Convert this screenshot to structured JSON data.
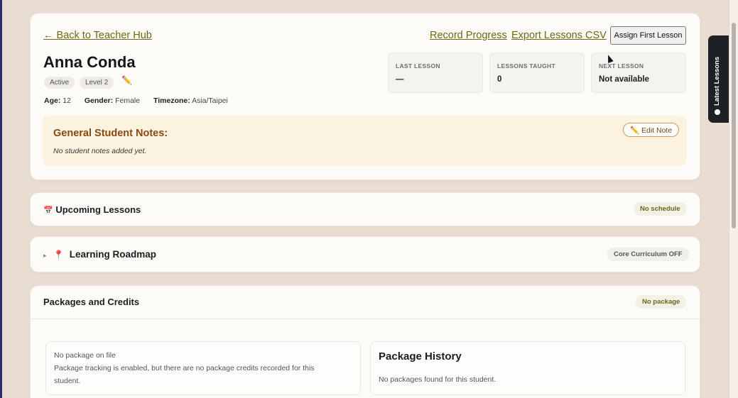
{
  "header": {
    "back_link": "← Back to Teacher Hub",
    "record_progress": "Record Progress",
    "export_csv": "Export Lessons CSV",
    "assign_first_lesson": "Assign First Lesson"
  },
  "student": {
    "name": "Anna Conda",
    "status": "Active",
    "level": "Level 2",
    "age_label": "Age:",
    "age": "12",
    "gender_label": "Gender:",
    "gender": "Female",
    "timezone_label": "Timezone:",
    "timezone": "Asia/Taipei"
  },
  "stats": [
    {
      "label": "LAST LESSON",
      "value": "—"
    },
    {
      "label": "LESSONS TAUGHT",
      "value": "0"
    },
    {
      "label": "NEXT LESSON",
      "value": "Not available"
    }
  ],
  "notes": {
    "title": "General Student Notes:",
    "empty": "No student notes added yet.",
    "edit_label": "✏️ Edit Note"
  },
  "upcoming": {
    "icon": "📅",
    "title": "Upcoming Lessons",
    "badge": "No schedule",
    "badge_color": "#5f6b1a"
  },
  "roadmap": {
    "caret": "▸",
    "icon": "📍",
    "title": "Learning Roadmap",
    "badge": "Core Curriculum OFF"
  },
  "packages": {
    "title": "Packages and Credits",
    "badge": "No package",
    "current": {
      "line1": "No package on file",
      "line2": "Package tracking is enabled, but there are no package credits recorded for this",
      "line3": "student."
    },
    "history": {
      "title": "Package History",
      "empty": "No packages found for this student."
    }
  },
  "latest_tab": {
    "label": "Latest Lessons"
  },
  "colors": {
    "link": "#6b6a12",
    "notes_bg": "#fbf2df",
    "notes_title": "#8a4a12",
    "page_bg": "#e9ddd2"
  }
}
